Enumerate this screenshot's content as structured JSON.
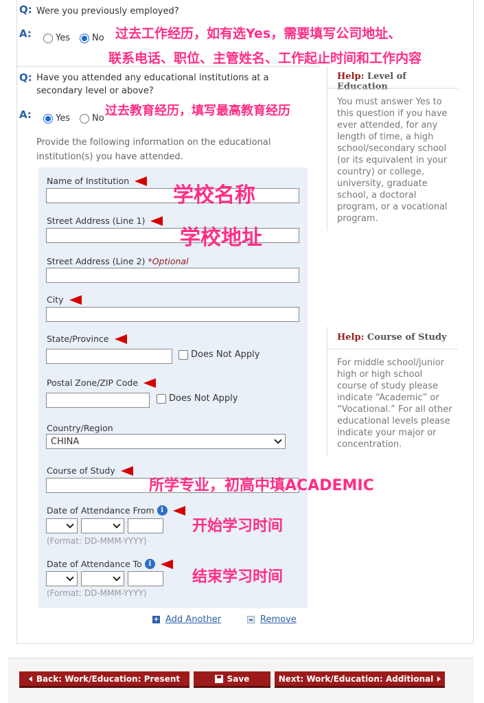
{
  "q1": {
    "q_marker": "Q:",
    "question": "Were you previously employed?",
    "a_marker": "A:",
    "yes_label": "Yes",
    "no_label": "No",
    "selected": "No",
    "note_line1": "过去工作经历，如有选Yes，需要填写公司地址、",
    "note_line2": "联系电话、职位、主管姓名、工作起止时间和工作内容"
  },
  "q2": {
    "q_marker": "Q:",
    "question_line1": "Have you attended any educational institutions at a",
    "question_line2": "secondary level or above?",
    "a_marker": "A:",
    "yes_label": "Yes",
    "no_label": "No",
    "selected": "Yes",
    "note": "过去教育经历，填写最高教育经历",
    "provide_line1": "Provide the following information on the educational",
    "provide_line2": "institution(s) you have attended."
  },
  "help_education": {
    "prefix": "Help:",
    "title": "Level of Education",
    "lines": [
      "You must answer Yes to",
      "this question if you have",
      "ever attended, for any",
      "length of time, a high",
      "school/secondary school",
      "(or its equivalent in your",
      "country) or college,",
      "university, graduate",
      "school, a doctoral",
      "program, or a vocational",
      "program."
    ]
  },
  "help_course": {
    "prefix": "Help:",
    "title": "Course of Study",
    "lines": [
      "For middle school/junior",
      "high or high school",
      "course of study please",
      "indicate “Academic” or",
      "“Vocational.” For all other",
      "educational levels please",
      "indicate your major or",
      "concentration."
    ]
  },
  "form": {
    "institution_label": "Name of Institution",
    "institution_note": "学校名称",
    "street1_label": "Street Address (Line 1)",
    "street1_note": "学校地址",
    "street2_label": "Street Address (Line 2)",
    "street2_optional": "*Optional",
    "city_label": "City",
    "state_label": "State/Province",
    "state_dna": "Does Not Apply",
    "postal_label": "Postal Zone/ZIP Code",
    "postal_dna": "Does Not Apply",
    "country_label": "Country/Region",
    "country_value": "CHINA",
    "course_label": "Course of Study",
    "course_note": "所学专业，初高中填ACADEMIC",
    "from_label": "Date of Attendance From",
    "from_note": "开始学习时间",
    "to_label": "Date of Attendance To",
    "to_note": "结束学习时间",
    "format_hint": "(Format: DD-MMM-YYYY)",
    "info_glyph": "i"
  },
  "actions": {
    "add_label": "Add Another",
    "remove_label": "Remove"
  },
  "nav": {
    "back_label": "Back: Work/Education: Present",
    "save_label": "Save",
    "next_label": "Next: Work/Education: Additional"
  },
  "colors": {
    "accent_blue": "#2a5ea8",
    "button_red": "#9d1b1b",
    "annotation_pink": "#ff2d86",
    "flag_red": "#d40000",
    "panel_bg": "#e9f0f8"
  }
}
